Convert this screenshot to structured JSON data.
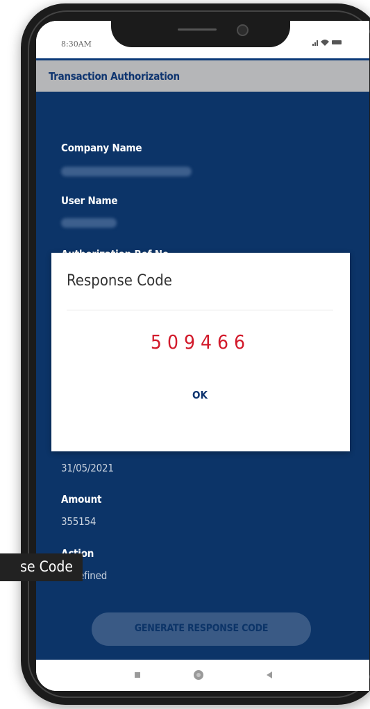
{
  "status_bar": {
    "time": "8:30AM",
    "icons": [
      "signal-icon",
      "wifi-icon",
      "battery-icon"
    ]
  },
  "header": {
    "title": "Transaction Authorization"
  },
  "fields": {
    "company_name_label": "Company Name",
    "user_name_label": "User Name",
    "auth_ref_label": "Authorization Ref No.",
    "date_value": "31/05/2021",
    "amount_label": "Amount",
    "amount_value": "355154",
    "action_label": "Action",
    "action_value": "undefined"
  },
  "buttons": {
    "generate_label": "GENERATE RESPONSE CODE"
  },
  "dialog": {
    "title": "Response Code",
    "code": "509466",
    "ok_label": "OK"
  },
  "tooltip": {
    "text": "se Code"
  },
  "nav": {
    "items": [
      "recent-apps-icon",
      "home-icon",
      "back-icon"
    ]
  },
  "colors": {
    "primary": "#0c3468",
    "header_bg": "#b5b6b8",
    "code_red": "#d21a2b",
    "button_bg": "#3a5a85"
  }
}
